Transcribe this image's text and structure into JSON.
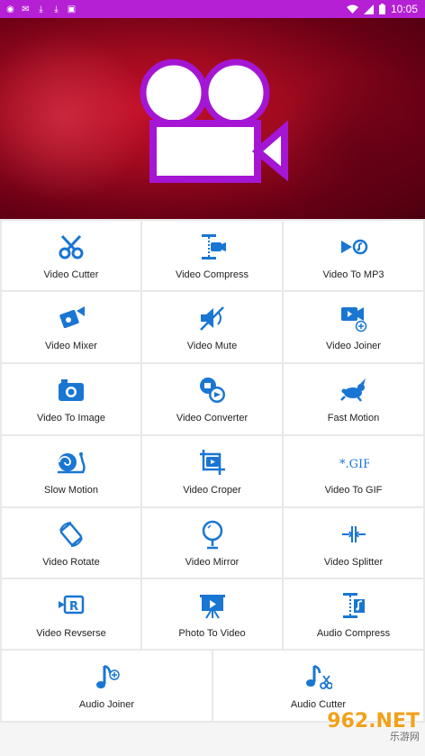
{
  "status_bar": {
    "time": "10:05"
  },
  "banner": {
    "logo": "video-camera-logo",
    "logo_color": "#a416d4"
  },
  "grid": {
    "rows": [
      [
        {
          "label": "Video Cutter",
          "icon": "scissors-icon"
        },
        {
          "label": "Video Compress",
          "icon": "compress-icon"
        },
        {
          "label": "Video To MP3",
          "icon": "mp3-icon"
        }
      ],
      [
        {
          "label": "Video Mixer",
          "icon": "mixer-icon"
        },
        {
          "label": "Video Mute",
          "icon": "mute-icon"
        },
        {
          "label": "Video Joiner",
          "icon": "joiner-icon"
        }
      ],
      [
        {
          "label": "Video To Image",
          "icon": "camera-icon"
        },
        {
          "label": "Video Converter",
          "icon": "converter-icon"
        },
        {
          "label": "Fast Motion",
          "icon": "rabbit-icon"
        }
      ],
      [
        {
          "label": "Slow Motion",
          "icon": "snail-icon"
        },
        {
          "label": "Video Croper",
          "icon": "crop-icon"
        },
        {
          "label": "Video To GIF",
          "icon": "gif-icon"
        }
      ],
      [
        {
          "label": "Video Rotate",
          "icon": "rotate-icon"
        },
        {
          "label": "Video Mirror",
          "icon": "mirror-icon"
        },
        {
          "label": "Video Splitter",
          "icon": "splitter-icon"
        }
      ],
      [
        {
          "label": "Video Revserse",
          "icon": "reverse-icon"
        },
        {
          "label": "Photo To Video",
          "icon": "photo-icon"
        },
        {
          "label": "Audio Compress",
          "icon": "audio-compress-icon"
        }
      ],
      [
        {
          "label": "Audio Joiner",
          "icon": "audio-joiner-icon"
        },
        {
          "label": "Audio Cutter",
          "icon": "audio-cutter-icon"
        }
      ]
    ]
  },
  "accent": "#1976d2",
  "watermark": {
    "text": "962.NET",
    "sub": "乐游网"
  }
}
